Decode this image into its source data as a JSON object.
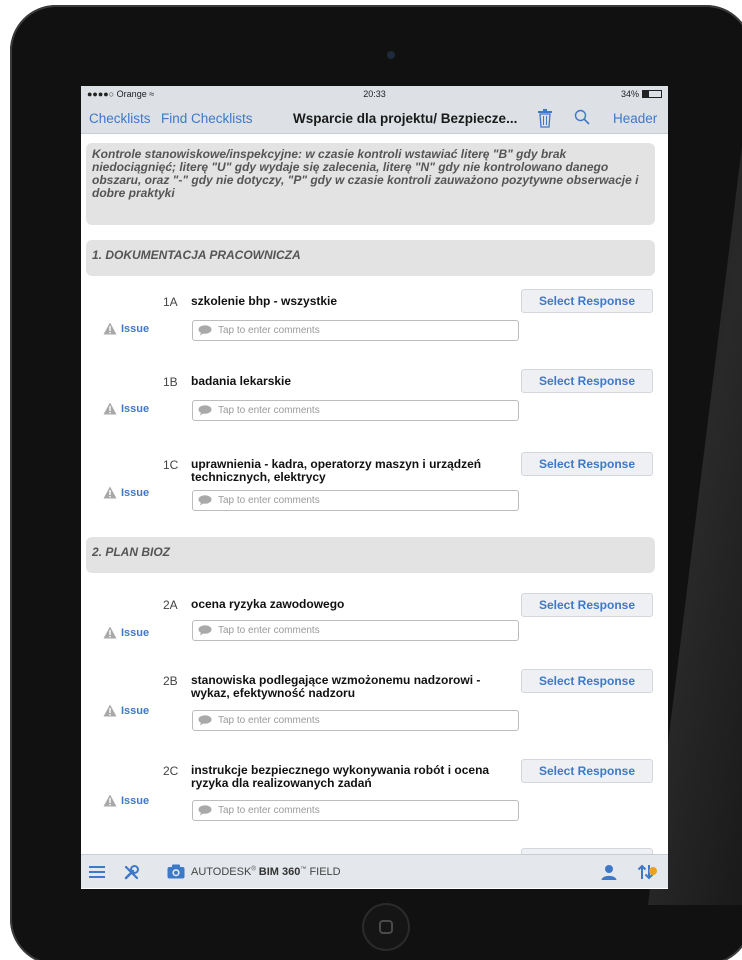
{
  "status_bar": {
    "carrier": "●●●●○ Orange ≈",
    "time": "20:33",
    "battery_level": "34%",
    "battery_fraction": 0.34
  },
  "nav": {
    "checklists": "Checklists",
    "find_checklists": "Find Checklists",
    "title": "Wsparcie dla projektu/ Bezpiecze...",
    "trash_icon": "trash-icon",
    "search_icon": "search-icon",
    "header": "Header"
  },
  "intro": "Kontrole stanowiskowe/inspekcyjne: w czasie kontroli wstawiać literę \"B\" gdy brak niedociągnięć; literę \"U\" gdy wydaje się zalecenia, literę \"N\"  gdy nie kontrolowano danego obszaru,  oraz \"-\" gdy nie dotyczy, \"P\" gdy w czasie kontroli zauważono pozytywne obserwacje i dobre praktyki",
  "sections": [
    {
      "title": "1. DOKUMENTACJA PRACOWNICZA",
      "items": [
        {
          "code": "1A",
          "text": "szkolenie bhp - wszystkie"
        },
        {
          "code": "1B",
          "text": "badania lekarskie"
        },
        {
          "code": "1C",
          "text": "uprawnienia - kadra, operatorzy maszyn i urządzeń technicznych, elektrycy"
        }
      ]
    },
    {
      "title": "2. PLAN BIOZ",
      "items": [
        {
          "code": "2A",
          "text": "ocena ryzyka zawodowego"
        },
        {
          "code": "2B",
          "text": "stanowiska podlegające wzmożonemu nadzorowi - wykaz, efektywność nadzoru"
        },
        {
          "code": "2C",
          "text": "instrukcje bezpiecznego wykonywania robót i ocena ryzyka dla realizowanych zadań"
        }
      ]
    }
  ],
  "labels": {
    "issue": "Issue",
    "select_response": "Select Response",
    "comment_placeholder": "Tap to enter comments"
  },
  "bottom_bar": {
    "brand_prefix": "AUTODESK",
    "brand_mark": "®",
    "brand_name": "BIM 360",
    "brand_tm": "™",
    "brand_suffix": "FIELD",
    "icons": [
      "menu-icon",
      "tools-icon",
      "camera-icon",
      "user-icon",
      "sync-icon"
    ]
  },
  "colors": {
    "accent": "#3d78c9",
    "bar": "#dde1e6",
    "section_bg": "#e3e3e3",
    "badge": "#f0a020"
  }
}
